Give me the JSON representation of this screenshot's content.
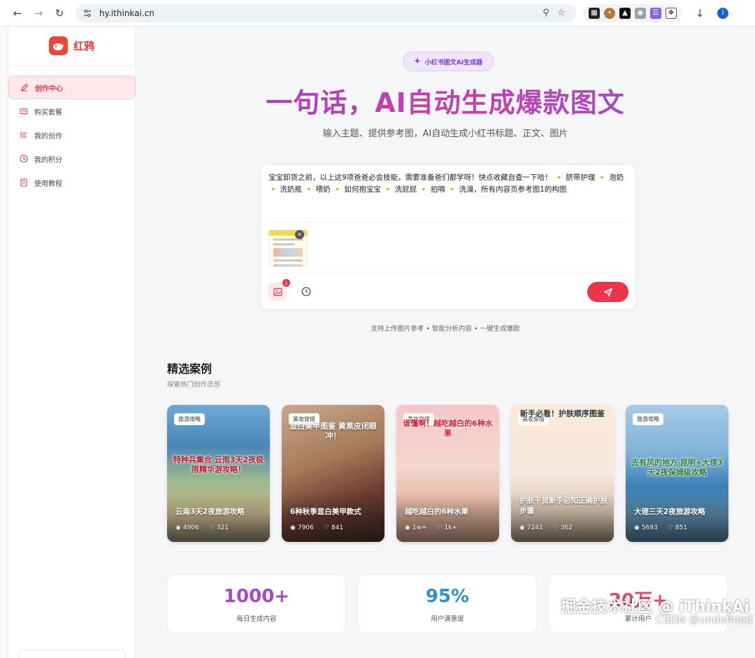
{
  "browser": {
    "url": "hy.ithinkai.cn",
    "profile_initial": "i"
  },
  "sidebar": {
    "brand_name": "红鸦",
    "items": [
      {
        "label": "创作中心",
        "icon": "pencil-icon",
        "active": true
      },
      {
        "label": "购买套餐",
        "icon": "card-icon",
        "active": false
      },
      {
        "label": "我的创作",
        "icon": "list-icon",
        "active": false
      },
      {
        "label": "我的积分",
        "icon": "clock-icon",
        "active": false
      },
      {
        "label": "使用教程",
        "icon": "book-icon",
        "active": false
      }
    ]
  },
  "hero": {
    "badge": "小红书图文AI生成器",
    "title": "一句话，AI自动生成爆款图文",
    "subtitle": "输入主题、提供参考图，AI自动生成小红书标题、正文、图片"
  },
  "composer": {
    "text": "宝宝卸货之前，以上这9项爸爸必会技能，需要准备爸们都学呀！快点收藏自查一下哈！ 🔸 脐带护理 🔸 泡奶 🔸 洗奶瓶 🔸 喂奶 🔸 如何抱宝宝 🔸 洗屁屁 🔸 拍嗝 🔸 洗澡，所有内容页参考图1的构图",
    "image_count": "1"
  },
  "support_text": "支持上传图片参考 • 智能分析内容 • 一键生成爆款",
  "featured": {
    "title": "精选案例",
    "subtitle": "探索热门创作灵感",
    "cards": [
      {
        "tag": "旅游攻略",
        "banner": "特种兵集合 云南3天2夜极限精华游攻略！",
        "caption": "云南3天2夜旅游攻略",
        "views": "4906",
        "likes": "321",
        "bg": "travel"
      },
      {
        "tag": "美妆穿搭",
        "banner": "显白美甲图鉴 黄黑皮闭眼冲！",
        "caption": "6种秋季显白美甲款式",
        "views": "7906",
        "likes": "841",
        "bg": "nails"
      },
      {
        "tag": "美妆穿搭",
        "banner": "谁懂啊！越吃越白的6种水果",
        "caption": "越吃越白的6种水果",
        "views": "1w+",
        "likes": "1k+",
        "bg": "fruit"
      },
      {
        "tag": "美妆穿搭",
        "banner": "新手必看！护肤顺序图鉴",
        "caption": "护肤干货新手必知正确护肤步骤",
        "views": "7241",
        "likes": "362",
        "bg": "skin"
      },
      {
        "tag": "旅游攻略",
        "banner": "去有风的地方 昆明+大理3天2夜保姆级攻略",
        "caption": "大理三天2夜旅游攻略",
        "views": "5693",
        "likes": "851",
        "bg": "sea"
      }
    ]
  },
  "stats": [
    {
      "value": "1000+",
      "label": "每日生成内容",
      "color": "#a14bd0"
    },
    {
      "value": "95%",
      "label": "用户满意度",
      "color": "#2f8fd4"
    },
    {
      "value": "20万+",
      "label": "累计用户",
      "color": "#e2476a"
    }
  ],
  "watermark": {
    "line1": "掘金技术社区 @ iThinkAi",
    "line2": "CSDN @undefined"
  }
}
